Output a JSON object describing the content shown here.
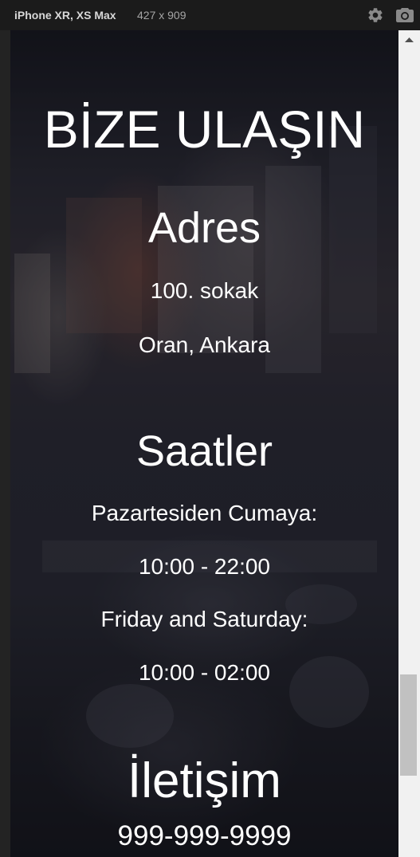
{
  "devtools": {
    "device_name": "iPhone XR, XS Max",
    "dimensions": "427 x 909",
    "settings_icon": "gear-icon",
    "screenshot_icon": "camera-icon"
  },
  "page": {
    "title": "BİZE ULAŞIN",
    "address": {
      "heading": "Adres",
      "line1": "100. sokak",
      "line2": "Oran, Ankara"
    },
    "hours": {
      "heading": "Saatler",
      "weekday_label": "Pazartesiden Cumaya:",
      "weekday_time": "10:00 - 22:00",
      "weekend_label": "Friday and Saturday:",
      "weekend_time": "10:00 - 02:00"
    },
    "contact": {
      "heading": "İletişim",
      "phone": "999-999-9999"
    }
  },
  "colors": {
    "devtools_bg": "#1b1b1b",
    "text": "#ffffff",
    "scrollbar_track": "#f1f1f1",
    "scrollbar_thumb": "#c1c1c1"
  }
}
